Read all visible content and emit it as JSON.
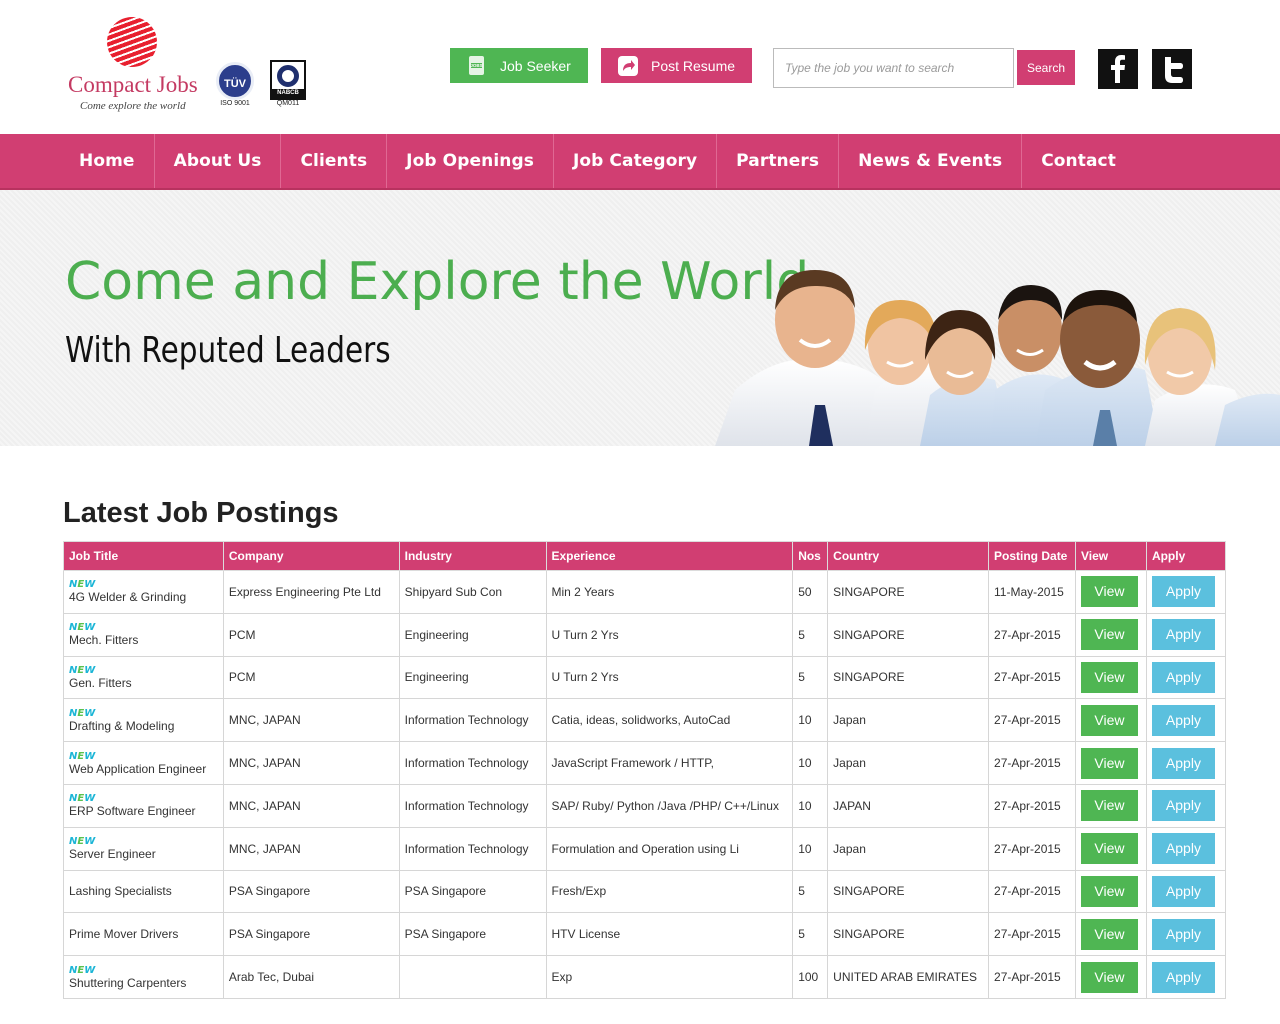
{
  "brand": {
    "name": "Compact Jobs",
    "tagline": "Come explore the world"
  },
  "certifications": [
    {
      "badge": "TÜV",
      "label": "ISO 9001"
    },
    {
      "badge": "NABCB",
      "label": "QM011"
    }
  ],
  "header": {
    "job_seeker_label": "Job Seeker",
    "post_resume_label": "Post Resume",
    "search_placeholder": "Type the job you want to search",
    "search_button": "Search",
    "social": [
      "facebook-icon",
      "twitter-icon"
    ]
  },
  "nav": [
    "Home",
    "About Us",
    "Clients",
    "Job Openings",
    "Job Category",
    "Partners",
    "News & Events",
    "Contact"
  ],
  "banner": {
    "title": "Come and Explore the World",
    "subtitle": "With Reputed Leaders"
  },
  "jobs": {
    "title": "Latest Job Postings",
    "new_label": "NEW",
    "columns": [
      "Job Title",
      "Company",
      "Industry",
      "Experience",
      "Nos",
      "Country",
      "Posting Date",
      "View",
      "Apply"
    ],
    "view_label": "View",
    "apply_label": "Apply",
    "rows": [
      {
        "is_new": true,
        "title": "4G Welder & Grinding",
        "company": "Express Engineering Pte Ltd",
        "industry": "Shipyard Sub Con",
        "experience": "Min 2 Years",
        "nos": "50",
        "country": "SINGAPORE",
        "date": "11-May-2015"
      },
      {
        "is_new": true,
        "title": "Mech. Fitters",
        "company": "PCM",
        "industry": "Engineering",
        "experience": "U Turn 2 Yrs",
        "nos": "5",
        "country": "SINGAPORE",
        "date": "27-Apr-2015"
      },
      {
        "is_new": true,
        "title": "Gen. Fitters",
        "company": "PCM",
        "industry": "Engineering",
        "experience": "U Turn 2 Yrs",
        "nos": "5",
        "country": "SINGAPORE",
        "date": "27-Apr-2015"
      },
      {
        "is_new": true,
        "title": "Drafting & Modeling",
        "company": "MNC, JAPAN",
        "industry": "Information Technology",
        "experience": "Catia, ideas, solidworks, AutoCad",
        "nos": "10",
        "country": "Japan",
        "date": "27-Apr-2015"
      },
      {
        "is_new": true,
        "title": "Web Application Engineer",
        "company": "MNC, JAPAN",
        "industry": "Information Technology",
        "experience": "JavaScript Framework / HTTP,",
        "nos": "10",
        "country": "Japan",
        "date": "27-Apr-2015"
      },
      {
        "is_new": true,
        "title": "ERP Software Engineer",
        "company": "MNC, JAPAN",
        "industry": "Information Technology",
        "experience": "SAP/ Ruby/ Python /Java /PHP/ C++/Linux",
        "nos": "10",
        "country": "JAPAN",
        "date": "27-Apr-2015"
      },
      {
        "is_new": true,
        "title": "Server Engineer",
        "company": "MNC, JAPAN",
        "industry": "Information Technology",
        "experience": "Formulation and Operation using Li",
        "nos": "10",
        "country": "Japan",
        "date": "27-Apr-2015"
      },
      {
        "is_new": false,
        "title": "Lashing Specialists",
        "company": "PSA Singapore",
        "industry": "PSA Singapore",
        "experience": "Fresh/Exp",
        "nos": "5",
        "country": "SINGAPORE",
        "date": "27-Apr-2015"
      },
      {
        "is_new": false,
        "title": "Prime Mover Drivers",
        "company": "PSA Singapore",
        "industry": "PSA Singapore",
        "experience": "HTV License",
        "nos": "5",
        "country": "SINGAPORE",
        "date": "27-Apr-2015"
      },
      {
        "is_new": true,
        "title": "Shuttering Carpenters",
        "company": "Arab Tec, Dubai",
        "industry": "",
        "experience": "Exp",
        "nos": "100",
        "country": "UNITED ARAB EMIRATES",
        "date": "27-Apr-2015"
      }
    ]
  },
  "colors": {
    "brand_pink": "#d13e72",
    "green": "#4fb653",
    "blue": "#5bc0de",
    "headline_green": "#4cae4f"
  }
}
